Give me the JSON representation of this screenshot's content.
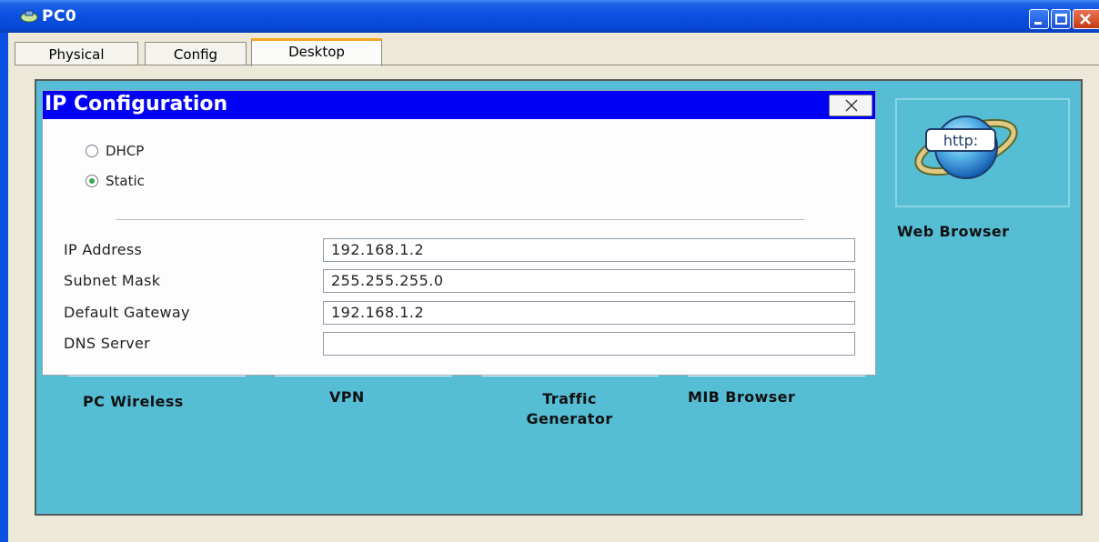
{
  "window": {
    "title": "PC0"
  },
  "tabs": [
    {
      "label": "Physical",
      "active": false
    },
    {
      "label": "Config",
      "active": false
    },
    {
      "label": "Desktop",
      "active": true
    }
  ],
  "dialog": {
    "title": "IP Configuration",
    "modes": [
      {
        "label": "DHCP",
        "checked": false
      },
      {
        "label": "Static",
        "checked": true
      }
    ],
    "fields": [
      {
        "label": "IP Address",
        "value": "192.168.1.2"
      },
      {
        "label": "Subnet Mask",
        "value": "255.255.255.0"
      },
      {
        "label": "Default Gateway",
        "value": "192.168.1.2"
      },
      {
        "label": "DNS Server",
        "value": ""
      }
    ]
  },
  "apps": {
    "web_browser": {
      "label": "Web Browser",
      "icon_text": "http:"
    },
    "pc_wireless": {
      "label": "PC Wireless"
    },
    "vpn": {
      "label": "VPN"
    },
    "traffic_generator": {
      "label_line1": "Traffic",
      "label_line2": "Generator"
    },
    "mib_browser": {
      "label": "MIB Browser"
    }
  },
  "colors": {
    "desktop_bg": "#55bdd4",
    "dialog_title_bg": "#0000f5",
    "titlebar_bg": "#0a4fe0",
    "active_tab_accent": "#f5a623"
  }
}
